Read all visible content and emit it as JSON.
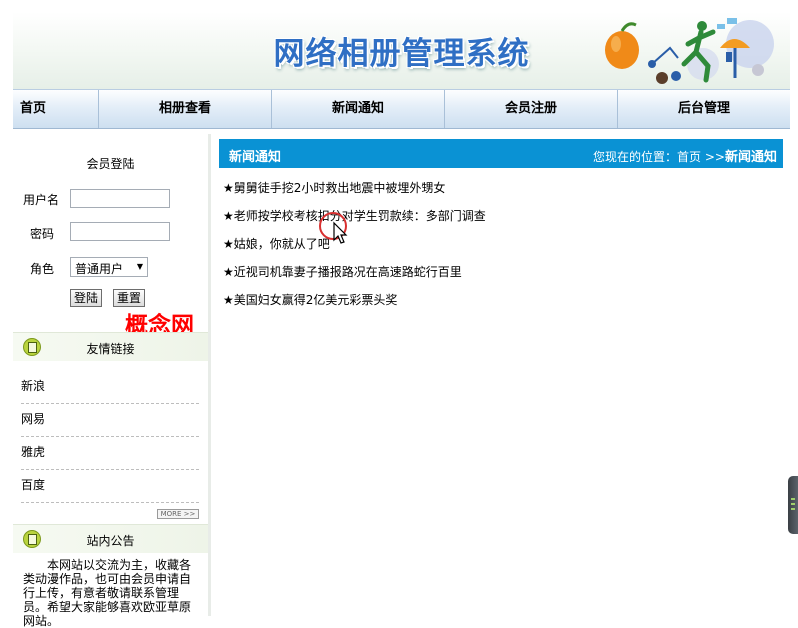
{
  "banner": {
    "title": "网络相册管理系统"
  },
  "nav": {
    "items": [
      {
        "label": "首页"
      },
      {
        "label": "相册查看"
      },
      {
        "label": "新闻通知"
      },
      {
        "label": "会员注册"
      },
      {
        "label": "后台管理"
      }
    ]
  },
  "login": {
    "title": "会员登陆",
    "username_label": "用户名",
    "username_value": "",
    "password_label": "密码",
    "password_value": "",
    "role_label": "角色",
    "role_selected": "普通用户",
    "login_button": "登陆",
    "reset_button": "重置"
  },
  "watermark": "概念网",
  "friend_links": {
    "title": "友情链接",
    "items": [
      "新浪",
      "网易",
      "雅虎",
      "百度"
    ],
    "more_label": "MORE >>"
  },
  "notice": {
    "title": "站内公告",
    "text": "本网站以交流为主，收藏各类动漫作品，也可由会员申请自行上传，有意者敬请联系管理员。希望大家能够喜欢欧亚草原网站。"
  },
  "main": {
    "title": "新闻通知",
    "breadcrumb_prefix": "您现在的位置：",
    "breadcrumb_home": "首页",
    "breadcrumb_sep": ">>",
    "breadcrumb_current": "新闻通知",
    "news": [
      "★舅舅徒手挖2小时救出地震中被埋外甥女",
      "★老师按学校考核扣分对学生罚款续：多部门调查",
      "★姑娘，你就从了吧",
      "★近视司机靠妻子播报路况在高速路蛇行百里",
      "★美国妇女赢得2亿美元彩票头奖"
    ]
  },
  "colors": {
    "nav_border": "#a9c0d8",
    "main_header": "#0a92d4",
    "title_blue": "#2f6fc4",
    "watermark_red": "#ff0000"
  }
}
